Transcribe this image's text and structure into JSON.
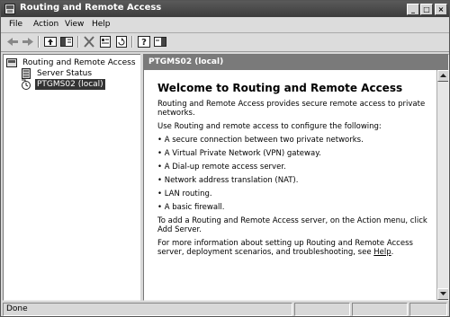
{
  "window": {
    "title": "Routing and Remote Access",
    "controls": {
      "minimize": "_",
      "maximize": "□",
      "close": "×"
    }
  },
  "menu": [
    "File",
    "Action",
    "View",
    "Help"
  ],
  "toolbar": {
    "buttons": [
      "back-arrow-icon",
      "forward-arrow-icon",
      "up-folder-icon",
      "show-hide-tree-icon",
      "delete-icon",
      "properties-icon",
      "refresh-icon",
      "export-list-icon",
      "help-icon",
      "console-pane-icon"
    ]
  },
  "tree": {
    "root": "Routing and Remote Access",
    "items": [
      "Server Status",
      "PTGMS02 (local)"
    ]
  },
  "content": {
    "header": "PTGMS02 (local)",
    "heading": "Welcome to Routing and Remote Access",
    "intro": "Routing and Remote Access provides secure remote access to private networks.",
    "configure_intro": "Use Routing and remote access to configure the following:",
    "bullets": [
      "• A secure connection between two private networks.",
      "• A Virtual Private Network (VPN) gateway.",
      "• A Dial-up remote access server.",
      "• Network address translation (NAT).",
      "• LAN routing.",
      "• A basic firewall."
    ],
    "add_server": "To add a Routing and Remote Access server, on the Action menu, click Add Server.",
    "more_info": "For more information about setting up Routing and Remote Access server, deployment scenarios, and troubleshooting, see",
    "help_link": "Help",
    "period": "."
  },
  "status": {
    "text": "Done"
  }
}
